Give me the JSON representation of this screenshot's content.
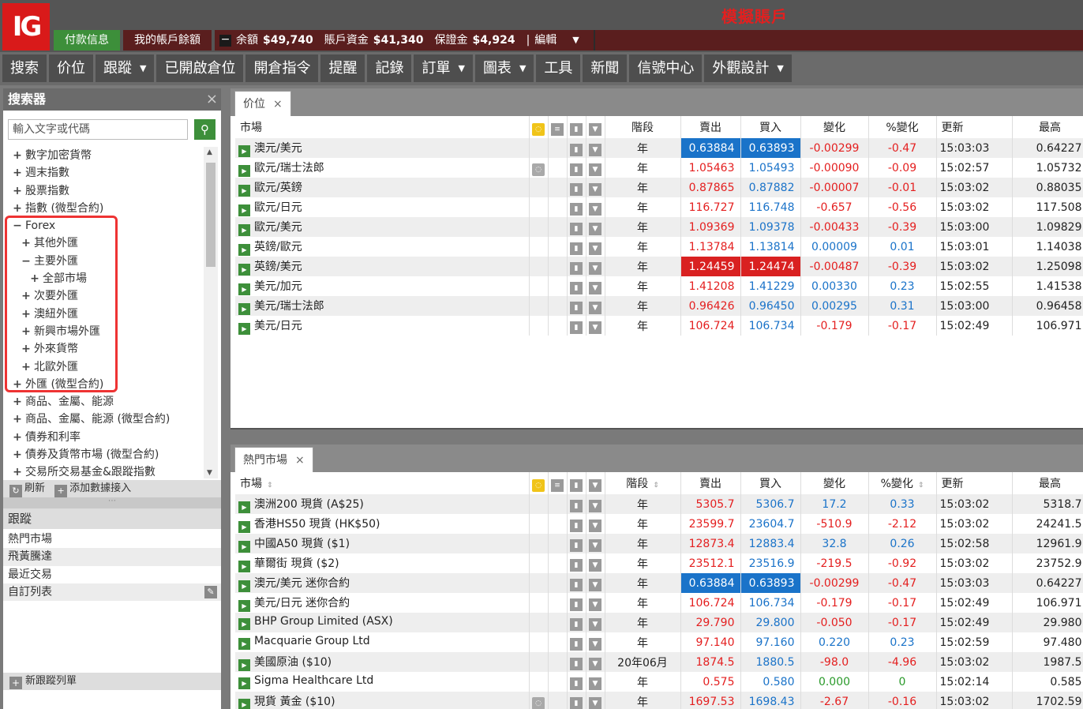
{
  "header": {
    "logo": "IG",
    "demo_label": "模擬賬戶",
    "payment_label": "付款信息",
    "balance_label": "我的帳戶餘額",
    "summary_toggle": "−",
    "balance_text": "余額",
    "balance_value": "$49,740",
    "funds_text": "賬戶資金",
    "funds_value": "$41,340",
    "margin_text": "保證金",
    "margin_value": "$4,924",
    "sep": "|",
    "edit_label": "編輯",
    "edit_caret": "▼"
  },
  "nav": [
    {
      "label": "搜索",
      "dropdown": false
    },
    {
      "label": "价位",
      "dropdown": false
    },
    {
      "label": "跟蹤",
      "dropdown": true
    },
    {
      "label": "已開啟倉位",
      "dropdown": false
    },
    {
      "label": "開倉指令",
      "dropdown": false
    },
    {
      "label": "提醒",
      "dropdown": false
    },
    {
      "label": "記錄",
      "dropdown": false
    },
    {
      "label": "訂單",
      "dropdown": true
    },
    {
      "label": "圖表",
      "dropdown": true
    },
    {
      "label": "工具",
      "dropdown": false
    },
    {
      "label": "新聞",
      "dropdown": false
    },
    {
      "label": "信號中心",
      "dropdown": false
    },
    {
      "label": "外觀設計",
      "dropdown": true
    }
  ],
  "search_panel": {
    "title": "搜索器",
    "close": "×",
    "placeholder": "輸入文字或代碼",
    "button_icon": "⚲",
    "tree": [
      {
        "toggle": "+",
        "label": "數字加密貨幣",
        "level": 0
      },
      {
        "toggle": "+",
        "label": "週末指數",
        "level": 0
      },
      {
        "toggle": "+",
        "label": "股票指數",
        "level": 0
      },
      {
        "toggle": "+",
        "label": "指數 (微型合約)",
        "level": 0
      },
      {
        "toggle": "−",
        "label": "Forex",
        "level": 0
      },
      {
        "toggle": "+",
        "label": "其他外匯",
        "level": 1
      },
      {
        "toggle": "−",
        "label": "主要外匯",
        "level": 1
      },
      {
        "toggle": "+",
        "label": "全部市場",
        "level": 2
      },
      {
        "toggle": "+",
        "label": "次要外匯",
        "level": 1
      },
      {
        "toggle": "+",
        "label": "澳紐外匯",
        "level": 1
      },
      {
        "toggle": "+",
        "label": "新興市場外匯",
        "level": 1
      },
      {
        "toggle": "+",
        "label": "外來貨幣",
        "level": 1
      },
      {
        "toggle": "+",
        "label": "北歐外匯",
        "level": 1
      },
      {
        "toggle": "+",
        "label": "外匯 (微型合約)",
        "level": 0
      },
      {
        "toggle": "+",
        "label": "商品、金屬、能源",
        "level": 0
      },
      {
        "toggle": "+",
        "label": "商品、金屬、能源 (微型合約)",
        "level": 0
      },
      {
        "toggle": "+",
        "label": "債券和利率",
        "level": 0
      },
      {
        "toggle": "+",
        "label": "債券及貨幣市場 (微型合約)",
        "level": 0
      },
      {
        "toggle": "+",
        "label": "交易所交易基金&跟蹤指數",
        "level": 0
      }
    ],
    "refresh_label": "刷新",
    "refresh_icon": "↻",
    "add_feed_label": "添加數據接入",
    "add_feed_icon": "+",
    "splitter": "⋯"
  },
  "watchlists": {
    "title": "跟蹤",
    "items": [
      "熱門市場",
      "飛黃騰達",
      "最近交易",
      "自訂列表"
    ],
    "new_label": "新跟蹤列單",
    "new_icon": "+",
    "edit_icon": "✎"
  },
  "columns": {
    "market": "市場",
    "period": "階段",
    "sell": "賣出",
    "buy": "買入",
    "change": "變化",
    "pct_change": "%變化",
    "update": "更新",
    "high": "最高"
  },
  "prices_panel": {
    "tab_label": "价位",
    "tab_close": "×",
    "rows": [
      {
        "market": "澳元/美元",
        "bulb": false,
        "period": "年",
        "sell": "0.63884",
        "buy": "0.63893",
        "change": "-0.00299",
        "pct": "-0.47",
        "update": "15:03:03",
        "high": "0.64227",
        "flash": "b"
      },
      {
        "market": "歐元/瑞士法郎",
        "bulb": true,
        "period": "年",
        "sell": "1.05463",
        "buy": "1.05493",
        "change": "-0.00090",
        "pct": "-0.09",
        "update": "15:02:57",
        "high": "1.05732",
        "flash": ""
      },
      {
        "market": "歐元/英鎊",
        "bulb": false,
        "period": "年",
        "sell": "0.87865",
        "buy": "0.87882",
        "change": "-0.00007",
        "pct": "-0.01",
        "update": "15:03:02",
        "high": "0.88035",
        "flash": ""
      },
      {
        "market": "歐元/日元",
        "bulb": false,
        "period": "年",
        "sell": "116.727",
        "buy": "116.748",
        "change": "-0.657",
        "pct": "-0.56",
        "update": "15:03:02",
        "high": "117.508",
        "flash": ""
      },
      {
        "market": "歐元/美元",
        "bulb": false,
        "period": "年",
        "sell": "1.09369",
        "buy": "1.09378",
        "change": "-0.00433",
        "pct": "-0.39",
        "update": "15:03:00",
        "high": "1.09829",
        "flash": ""
      },
      {
        "market": "英鎊/歐元",
        "bulb": false,
        "period": "年",
        "sell": "1.13784",
        "buy": "1.13814",
        "change": "0.00009",
        "pct": "0.01",
        "update": "15:03:01",
        "high": "1.14038",
        "flash": ""
      },
      {
        "market": "英鎊/美元",
        "bulb": false,
        "period": "年",
        "sell": "1.24459",
        "buy": "1.24474",
        "change": "-0.00487",
        "pct": "-0.39",
        "update": "15:03:02",
        "high": "1.25098",
        "flash": "r"
      },
      {
        "market": "美元/加元",
        "bulb": false,
        "period": "年",
        "sell": "1.41208",
        "buy": "1.41229",
        "change": "0.00330",
        "pct": "0.23",
        "update": "15:02:55",
        "high": "1.41538",
        "flash": ""
      },
      {
        "market": "美元/瑞士法郎",
        "bulb": false,
        "period": "年",
        "sell": "0.96426",
        "buy": "0.96450",
        "change": "0.00295",
        "pct": "0.31",
        "update": "15:03:00",
        "high": "0.96458",
        "flash": ""
      },
      {
        "market": "美元/日元",
        "bulb": false,
        "period": "年",
        "sell": "106.724",
        "buy": "106.734",
        "change": "-0.179",
        "pct": "-0.17",
        "update": "15:02:49",
        "high": "106.971",
        "flash": ""
      }
    ]
  },
  "hot_panel": {
    "tab_label": "熱門市場",
    "tab_close": "×",
    "rows": [
      {
        "market": "澳洲200 現貨 (A$25)",
        "bulb": false,
        "period": "年",
        "sell": "5305.7",
        "buy": "5306.7",
        "change": "17.2",
        "pct": "0.33",
        "update": "15:03:02",
        "high": "5318.7",
        "flash": ""
      },
      {
        "market": "香港HS50 現貨 (HK$50)",
        "bulb": false,
        "period": "年",
        "sell": "23599.7",
        "buy": "23604.7",
        "change": "-510.9",
        "pct": "-2.12",
        "update": "15:03:02",
        "high": "24241.5",
        "flash": ""
      },
      {
        "market": "中國A50 現貨 ($1)",
        "bulb": false,
        "period": "年",
        "sell": "12873.4",
        "buy": "12883.4",
        "change": "32.8",
        "pct": "0.26",
        "update": "15:02:58",
        "high": "12961.9",
        "flash": ""
      },
      {
        "market": "華爾街 現貨 ($2)",
        "bulb": false,
        "period": "年",
        "sell": "23512.1",
        "buy": "23516.9",
        "change": "-219.5",
        "pct": "-0.92",
        "update": "15:03:02",
        "high": "23752.9",
        "flash": ""
      },
      {
        "market": "澳元/美元 迷你合約",
        "bulb": false,
        "period": "年",
        "sell": "0.63884",
        "buy": "0.63893",
        "change": "-0.00299",
        "pct": "-0.47",
        "update": "15:03:03",
        "high": "0.64227",
        "flash": "b"
      },
      {
        "market": "美元/日元 迷你合約",
        "bulb": false,
        "period": "年",
        "sell": "106.724",
        "buy": "106.734",
        "change": "-0.179",
        "pct": "-0.17",
        "update": "15:02:49",
        "high": "106.971",
        "flash": ""
      },
      {
        "market": "BHP Group Limited (ASX)",
        "bulb": false,
        "period": "年",
        "sell": "29.790",
        "buy": "29.800",
        "change": "-0.050",
        "pct": "-0.17",
        "update": "15:02:49",
        "high": "29.980",
        "flash": ""
      },
      {
        "market": "Macquarie Group Ltd",
        "bulb": false,
        "period": "年",
        "sell": "97.140",
        "buy": "97.160",
        "change": "0.220",
        "pct": "0.23",
        "update": "15:02:59",
        "high": "97.480",
        "flash": ""
      },
      {
        "market": "美國原油 ($10)",
        "bulb": false,
        "period": "20年06月",
        "sell": "1874.5",
        "buy": "1880.5",
        "change": "-98.0",
        "pct": "-4.96",
        "update": "15:03:02",
        "high": "1987.5",
        "flash": ""
      },
      {
        "market": "Sigma Healthcare Ltd",
        "bulb": false,
        "period": "年",
        "sell": "0.575",
        "buy": "0.580",
        "change": "0.000",
        "pct": "0",
        "update": "15:02:14",
        "high": "0.585",
        "flash": ""
      },
      {
        "market": "現貨 黃金 ($10)",
        "bulb": true,
        "period": "年",
        "sell": "1697.53",
        "buy": "1698.43",
        "change": "-2.67",
        "pct": "-0.16",
        "update": "15:03:02",
        "high": "1702.59",
        "flash": ""
      }
    ]
  },
  "colors": {
    "accent_green": "#3d8f3a",
    "header_maroon": "#5a1e1e",
    "logo_red": "#d91a1a",
    "negative": "#e41f1f",
    "positive": "#1a73c9"
  }
}
